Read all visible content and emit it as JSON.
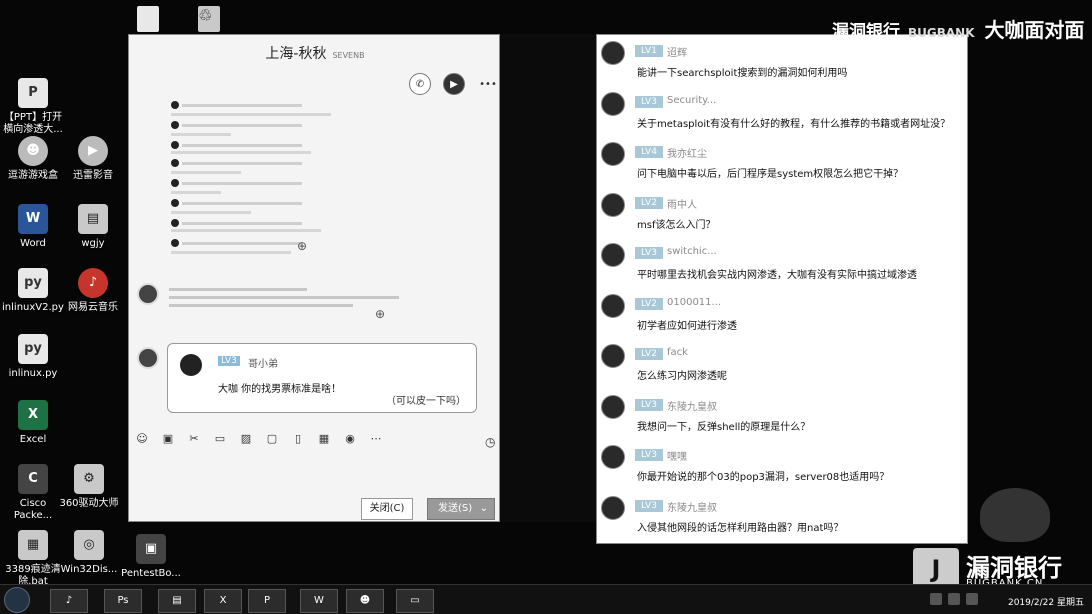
{
  "desktop": {
    "icons": [
      {
        "label": "【PPT】打开横向渗透大...",
        "icon": "doc-icon"
      },
      {
        "label": "逗游游戏盒",
        "icon": "game-icon"
      },
      {
        "label": "迅雷影音",
        "icon": "player-icon"
      },
      {
        "label": "Word",
        "icon": "word-icon"
      },
      {
        "label": "wgjy",
        "icon": "file-icon"
      },
      {
        "label": "inlinuxV2.py",
        "icon": "python-icon"
      },
      {
        "label": "网易云音乐",
        "icon": "music-icon"
      },
      {
        "label": "inlinux.py",
        "icon": "python-icon"
      },
      {
        "label": "Excel",
        "icon": "excel-icon"
      },
      {
        "label": "Cisco Packe...",
        "icon": "cisco-icon"
      },
      {
        "label": "360驱动大师",
        "icon": "driver-icon"
      },
      {
        "label": "3389痕迹清除.bat",
        "icon": "bat-icon"
      },
      {
        "label": "Win32Dis...",
        "icon": "disk-icon"
      },
      {
        "label": "PentestBo...",
        "icon": "box-icon"
      }
    ]
  },
  "chat": {
    "title": "上海-秋秋",
    "title_small": "SEVENB",
    "quote": {
      "level": "LV3",
      "name": "哥小弟",
      "text": "大咖 你的找男票标准是啥！",
      "reply": "（可以皮一下吗）"
    },
    "close_label": "关闭(C)",
    "send_label": "发送(S)"
  },
  "qa": [
    {
      "level": "LV1",
      "name": "迢辉",
      "question": "能讲一下searchsploit搜索到的漏洞如何利用吗"
    },
    {
      "level": "LV3",
      "name": "Security...",
      "question": "关于metasploit有没有什么好的教程，有什么推荐的书籍或者网址没？"
    },
    {
      "level": "LV4",
      "name": "我亦红尘",
      "question": "问下电脑中毒以后，后门程序是system权限怎么把它干掉？"
    },
    {
      "level": "LV2",
      "name": "雨中人",
      "question": "msf该怎么入门？"
    },
    {
      "level": "LV3",
      "name": "switchic...",
      "question": "平时哪里去找机会实战内网渗透，大咖有没有实际中搞过域渗透"
    },
    {
      "level": "LV2",
      "name": "0100011...",
      "question": "初学者应如何进行渗透"
    },
    {
      "level": "LV2",
      "name": "fack",
      "question": "怎么练习内网渗透呢"
    },
    {
      "level": "LV3",
      "name": "东陵九皇叔",
      "question": "我想问一下，反弹shell的原理是什么？"
    },
    {
      "level": "LV3",
      "name": "嘿嘿",
      "question": "你最开始说的那个03的pop3漏洞，server08也适用吗？"
    },
    {
      "level": "LV3",
      "name": "东陵九皇叔",
      "question": "入侵其他网段的话怎样利用路由器？用nat吗？"
    }
  ],
  "watermark": {
    "top": "漏洞银行",
    "top_sub": "BUGBANK",
    "top_big": "大咖面对面",
    "logo_name": "漏洞银行",
    "logo_url": "BUGBANK.CN"
  },
  "taskbar": {
    "clock": "2019/2/22 星期五"
  }
}
